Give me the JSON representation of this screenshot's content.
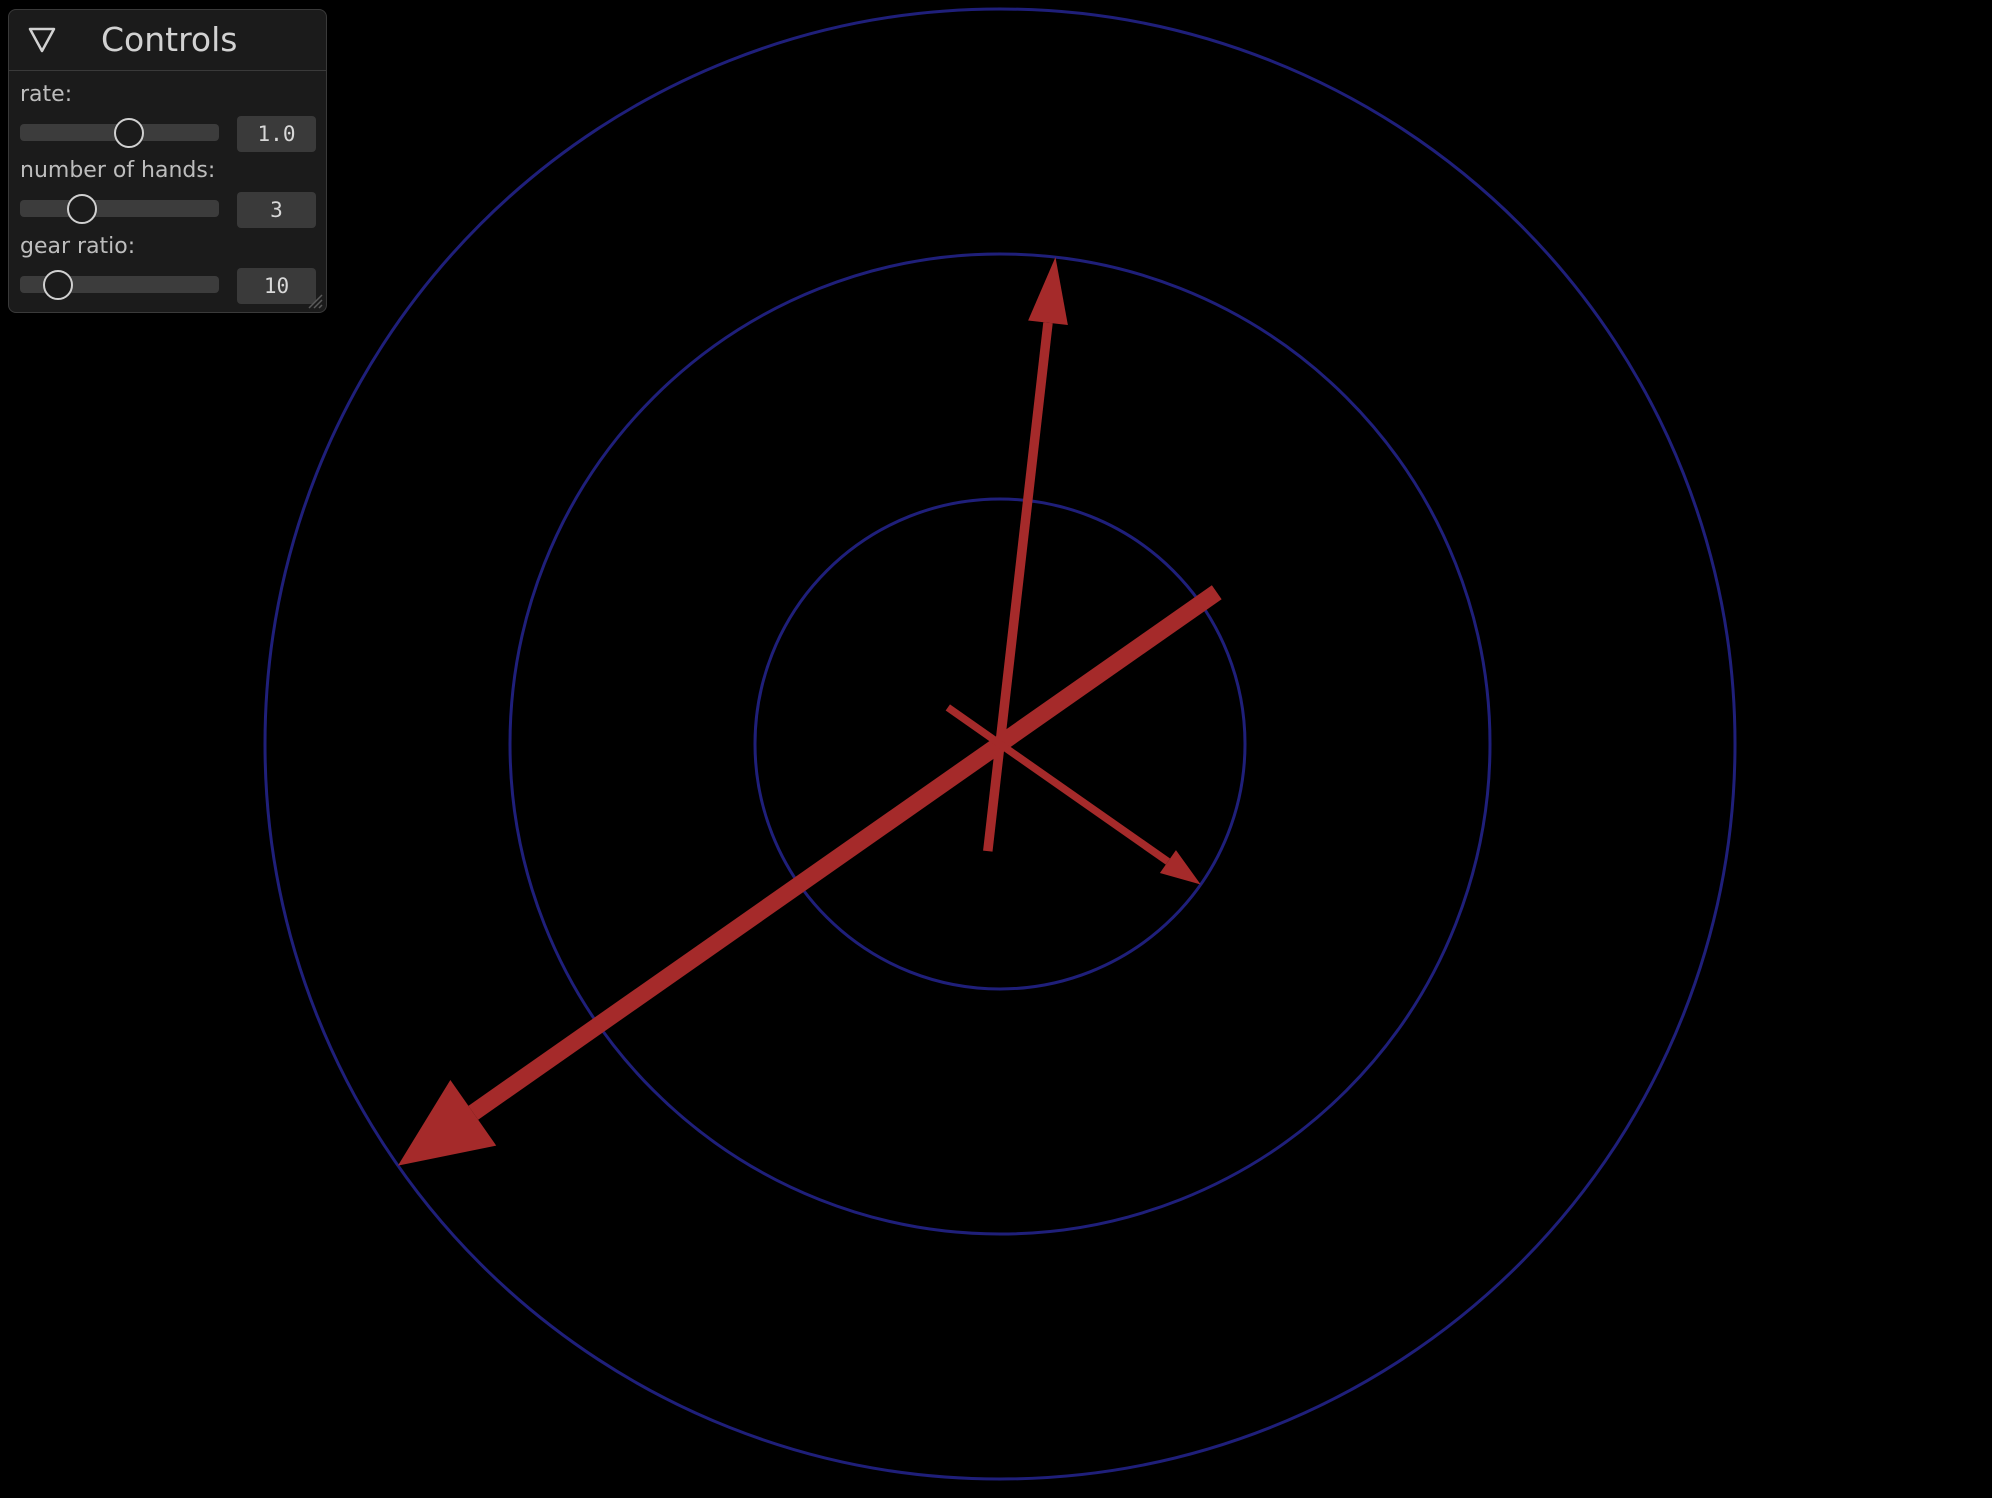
{
  "panel": {
    "title": "Controls",
    "collapse_icon": "triangle-down-icon",
    "controls": [
      {
        "label": "rate:",
        "value": "1.0",
        "slider_position": 0.55
      },
      {
        "label": "number of hands:",
        "value": "3",
        "slider_position": 0.31
      },
      {
        "label": "gear ratio:",
        "value": "10",
        "slider_position": 0.19
      }
    ]
  },
  "scene": {
    "background_color": "#000000",
    "ring_color": "#1f1f7a",
    "hand_color": "#a52a2a",
    "hand_angles_deg": [
      215,
      83.5,
      325
    ],
    "ring_count": 3
  }
}
